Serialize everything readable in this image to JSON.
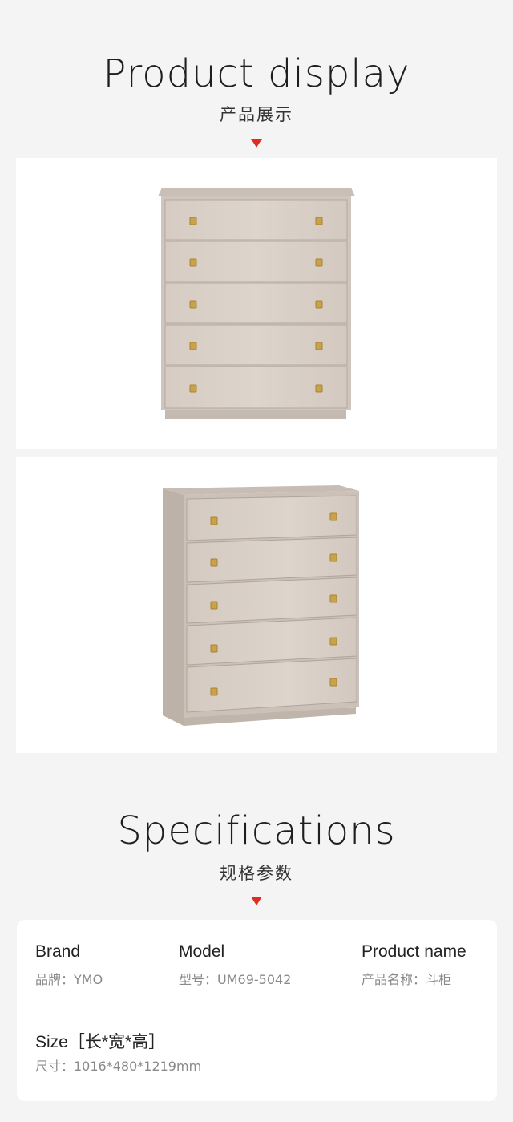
{
  "display": {
    "title_en": "Product display",
    "title_cn": "产品展示"
  },
  "images": [
    {
      "name": "chest-front-view"
    },
    {
      "name": "chest-angled-view"
    }
  ],
  "specs": {
    "title_en": "Specifications",
    "title_cn": "规格参数",
    "brand": {
      "label": "Brand",
      "value": "品牌：YMO"
    },
    "model": {
      "label": "Model",
      "value": "型号：UM69-5042"
    },
    "product_name": {
      "label": "Product name",
      "value": "产品名称：斗柜"
    },
    "size": {
      "label": "Size［长*宽*高］",
      "value": "尺寸：1016*480*1219mm"
    }
  },
  "colors": {
    "accent": "#e02b20",
    "wood": "#d9cfc6",
    "handle": "#c9a24a"
  }
}
